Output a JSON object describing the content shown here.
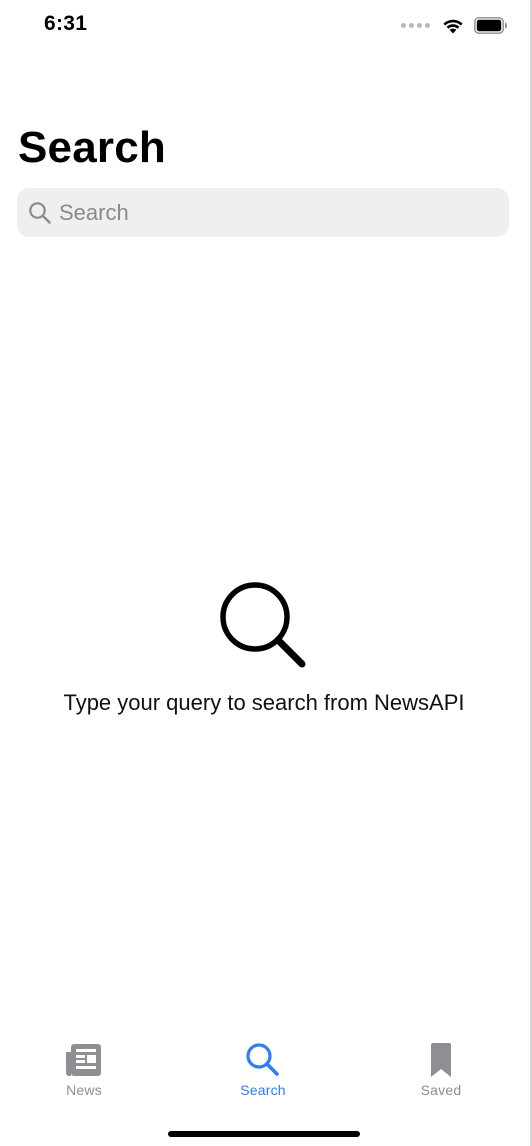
{
  "status_bar": {
    "time": "6:31"
  },
  "page": {
    "title": "Search"
  },
  "search": {
    "placeholder": "Search",
    "value": ""
  },
  "empty_state": {
    "icon": "magnifying-glass-icon",
    "message": "Type your query to search from NewsAPI"
  },
  "tab_bar": {
    "tabs": [
      {
        "label": "News",
        "icon": "newspaper-icon",
        "active": false
      },
      {
        "label": "Search",
        "icon": "magnifying-glass-icon",
        "active": true
      },
      {
        "label": "Saved",
        "icon": "bookmark-icon",
        "active": false
      }
    ]
  },
  "colors": {
    "accent": "#2f7cf6",
    "inactive_tab": "#8e8e93",
    "search_field_bg": "#efefef"
  }
}
